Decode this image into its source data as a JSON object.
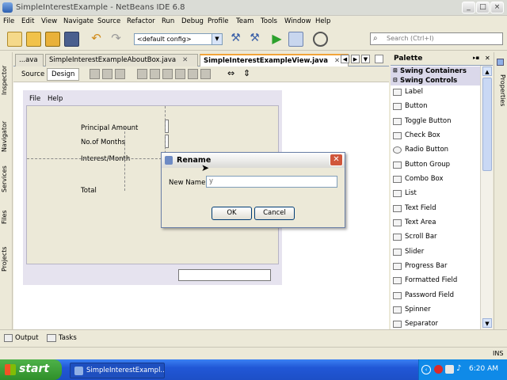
{
  "window": {
    "title": "SimpleInterestExample - NetBeans IDE 6.8",
    "controls": [
      "_",
      "□",
      "×"
    ]
  },
  "menubar": [
    "File",
    "Edit",
    "View",
    "Navigate",
    "Source",
    "Refactor",
    "Run",
    "Debug",
    "Profile",
    "Team",
    "Tools",
    "Window",
    "Help"
  ],
  "toolbar": {
    "config_value": "<default config>",
    "search_placeholder": "Search (Ctrl+I)"
  },
  "side_tabs_left": [
    "Inspector",
    "Navigator",
    "Services",
    "Files",
    "Projects"
  ],
  "side_tabs_right": [
    "Properties"
  ],
  "editor_tabs": [
    {
      "label": "...ava",
      "active": false
    },
    {
      "label": "SimpleInterestExampleAboutBox.java",
      "active": false
    },
    {
      "label": "SimpleInterestExampleView.java",
      "active": true
    }
  ],
  "editor_modes": {
    "source": "Source",
    "design": "Design"
  },
  "form": {
    "menu": [
      "File",
      "Help"
    ],
    "labels": [
      "Principal Amount",
      "No.of Months",
      "Interest/Month",
      "Total"
    ]
  },
  "dialog": {
    "title": "Rename",
    "field_label": "New Name:",
    "field_value": "y",
    "ok_label": "OK",
    "cancel_label": "Cancel"
  },
  "palette": {
    "title": "Palette",
    "categories": [
      {
        "label": "Swing Containers",
        "expanded": false
      },
      {
        "label": "Swing Controls",
        "expanded": true
      }
    ],
    "items": [
      "Label",
      "Button",
      "Toggle Button",
      "Check Box",
      "Radio Button",
      "Button Group",
      "Combo Box",
      "List",
      "Text Field",
      "Text Area",
      "Scroll Bar",
      "Slider",
      "Progress Bar",
      "Formatted Field",
      "Password Field",
      "Spinner",
      "Separator"
    ]
  },
  "bottom_tabs": [
    "Output",
    "Tasks"
  ],
  "status": {
    "mode": "INS"
  },
  "taskbar": {
    "start_label": "start",
    "task_label": "SimpleInterestExampl...",
    "clock": "6:20 AM"
  }
}
